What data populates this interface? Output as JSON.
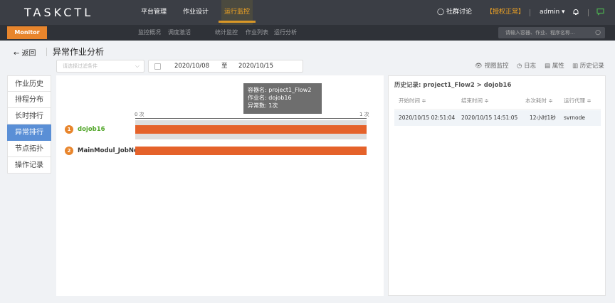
{
  "app": {
    "logo": "TASKCTL",
    "nav": [
      "平台管理",
      "作业设计",
      "运行监控"
    ],
    "nav_active_index": 2,
    "community": "社群讨论",
    "license": "【授权正常】",
    "user": "admin ▾"
  },
  "subbar": {
    "badge": "Monitor",
    "items": [
      "监控概况",
      "调度激活",
      "统计监控",
      "作业列表",
      "运行分析"
    ],
    "search_placeholder": "请输入容器、作业、程序名称..."
  },
  "page": {
    "back_label": "← 返回",
    "title": "异常作业分析",
    "filter_placeholder": "请选择过滤条件",
    "date_from": "2020/10/08",
    "date_sep": "至",
    "date_to": "2020/10/15",
    "actions": [
      "视图监控",
      "日志",
      "属性",
      "历史记录"
    ]
  },
  "side_tabs": {
    "items": [
      "作业历史",
      "排程分布",
      "长时排行",
      "异常排行",
      "节点拓扑",
      "操作记录"
    ],
    "active_index": 3
  },
  "chart_data": {
    "type": "bar",
    "orientation": "horizontal",
    "categories": [
      "dojob16",
      "MainModul_JobNod"
    ],
    "values": [
      1,
      1
    ],
    "xlim": [
      0,
      1
    ],
    "x_tick_labels": [
      "0 次",
      "1 次"
    ],
    "tooltip": {
      "lines": [
        "容器名: project1_Flow2",
        "作业名: dojob16",
        "异常数: 1次"
      ]
    },
    "colors": {
      "bar": "#e5622a",
      "rank_badge": "#e8852c",
      "first_label": "#52a62a"
    }
  },
  "history": {
    "title": "历史记录: project1_Flow2 > dojob16",
    "columns": [
      "开始时间 ≑",
      "结束时间 ≑",
      "本次耗时 ≑",
      "运行代理 ≑"
    ],
    "rows": [
      [
        "2020/10/15 02:51:04",
        "2020/10/15 14:51:05",
        "12小时1秒",
        "svrnode"
      ]
    ]
  }
}
